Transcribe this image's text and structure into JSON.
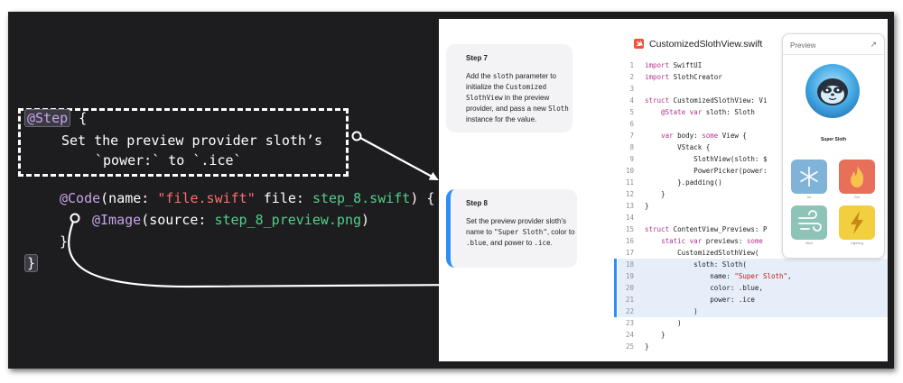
{
  "left_code": {
    "line1_attr": "@Step",
    "line1_brace": " {",
    "line2": "Set the preview provider sloth’s",
    "line3": "`power:` to `.ice`",
    "line4_attr": "@Code",
    "line4_pre": "(name: ",
    "line4_str": "\"file.swift\"",
    "line4_mid": " file: ",
    "line4_file": "step_8.swift",
    "line4_end": ") {",
    "line5_attr": "@Image",
    "line5_pre": "(source: ",
    "line5_file": "step_8_preview.png",
    "line5_end": ")",
    "line6": "}",
    "line7": "}"
  },
  "steps": [
    {
      "title": "Step 7",
      "body_parts": [
        "Add the ",
        "sloth",
        " parameter to initialize the ",
        "Customized SlothView",
        " in the preview provider, and pass a new ",
        "Sloth",
        " instance for the value."
      ]
    },
    {
      "title": "Step 8",
      "body_parts": [
        "Set the preview provider sloth’s name to ",
        "\"Super Sloth\"",
        ", color to ",
        ".blue",
        ", and power to ",
        ".ice",
        "."
      ]
    }
  ],
  "editor": {
    "file_name": "CustomizedSlothView.swift",
    "lines": [
      {
        "n": "1",
        "t": "import SwiftUI"
      },
      {
        "n": "2",
        "t": "import SlothCreator"
      },
      {
        "n": "3",
        "t": ""
      },
      {
        "n": "4",
        "t": "struct CustomizedSlothView: Vi"
      },
      {
        "n": "5",
        "t": "    @State var sloth: Sloth"
      },
      {
        "n": "6",
        "t": ""
      },
      {
        "n": "7",
        "t": "    var body: some View {"
      },
      {
        "n": "8",
        "t": "        VStack {"
      },
      {
        "n": "9",
        "t": "            SlothView(sloth: $"
      },
      {
        "n": "10",
        "t": "            PowerPicker(power:"
      },
      {
        "n": "11",
        "t": "        }.padding()"
      },
      {
        "n": "12",
        "t": "    }"
      },
      {
        "n": "13",
        "t": "}"
      },
      {
        "n": "14",
        "t": ""
      },
      {
        "n": "15",
        "t": "struct ContentView_Previews: P"
      },
      {
        "n": "16",
        "t": "    static var previews: some"
      },
      {
        "n": "17",
        "t": "        CustomizedSlothView("
      },
      {
        "n": "18",
        "t": "            sloth: Sloth("
      },
      {
        "n": "19",
        "t": "                name: \"Super Sloth\","
      },
      {
        "n": "20",
        "t": "                color: .blue,"
      },
      {
        "n": "21",
        "t": "                power: .ice"
      },
      {
        "n": "22",
        "t": "            )"
      },
      {
        "n": "23",
        "t": "        )"
      },
      {
        "n": "24",
        "t": "    }"
      },
      {
        "n": "25",
        "t": "}"
      }
    ]
  },
  "preview": {
    "title": "Preview",
    "sloth_name": "Super Sloth",
    "powers": [
      "Ice",
      "Fire",
      "Wind",
      "Lightning"
    ]
  },
  "colors": {
    "accent": "#2f8ef5",
    "background": "#1d1d1f"
  }
}
